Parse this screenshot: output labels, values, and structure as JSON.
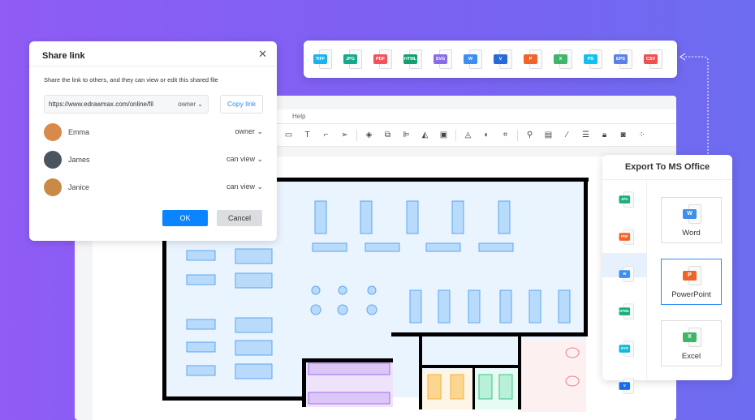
{
  "editor": {
    "menu": {
      "help": "Help"
    }
  },
  "share": {
    "title": "Share link",
    "description": "Share the link to others, and they can view or edit this shared file",
    "url": "https://www.edrawmax.com/online/fil",
    "url_permission": "owner",
    "copy_label": "Copy link",
    "users": [
      {
        "name": "Emma",
        "role": "owner",
        "avatar_color": "#d9894a"
      },
      {
        "name": "James",
        "role": "can view",
        "avatar_color": "#4a5560"
      },
      {
        "name": "Janice",
        "role": "can view",
        "avatar_color": "#c98a45"
      }
    ],
    "ok_label": "OK",
    "cancel_label": "Cancel"
  },
  "formats": [
    {
      "label": "TIFF",
      "color": "#1ab2f0"
    },
    {
      "label": "JPG",
      "color": "#16a88a"
    },
    {
      "label": "PDF",
      "color": "#f0545a"
    },
    {
      "label": "HTML",
      "color": "#12a070"
    },
    {
      "label": "SVG",
      "color": "#8a6be6"
    },
    {
      "label": "W",
      "color": "#3d8ef0"
    },
    {
      "label": "V",
      "color": "#2a68d8"
    },
    {
      "label": "P",
      "color": "#f0642a"
    },
    {
      "label": "X",
      "color": "#3fb56a"
    },
    {
      "label": "PS",
      "color": "#12c0f0"
    },
    {
      "label": "EPS",
      "color": "#5b80e8"
    },
    {
      "label": "CSV",
      "color": "#ee5050"
    }
  ],
  "export": {
    "title": "Export To MS Office",
    "side": [
      {
        "label": "JPG",
        "color": "#16b07a"
      },
      {
        "label": "PDF",
        "color": "#f0642a"
      },
      {
        "label": "W",
        "color": "#3d8ef0"
      },
      {
        "label": "HTML",
        "color": "#16b07a"
      },
      {
        "label": "SVG",
        "color": "#12b8d8"
      },
      {
        "label": "V",
        "color": "#1a6de8"
      }
    ],
    "cards": [
      {
        "label": "Word",
        "icon": "W",
        "color": "#3d8ef0"
      },
      {
        "label": "PowerPoint",
        "icon": "P",
        "color": "#f0642a",
        "selected": true
      },
      {
        "label": "Excel",
        "icon": "X",
        "color": "#3fb56a"
      }
    ]
  }
}
